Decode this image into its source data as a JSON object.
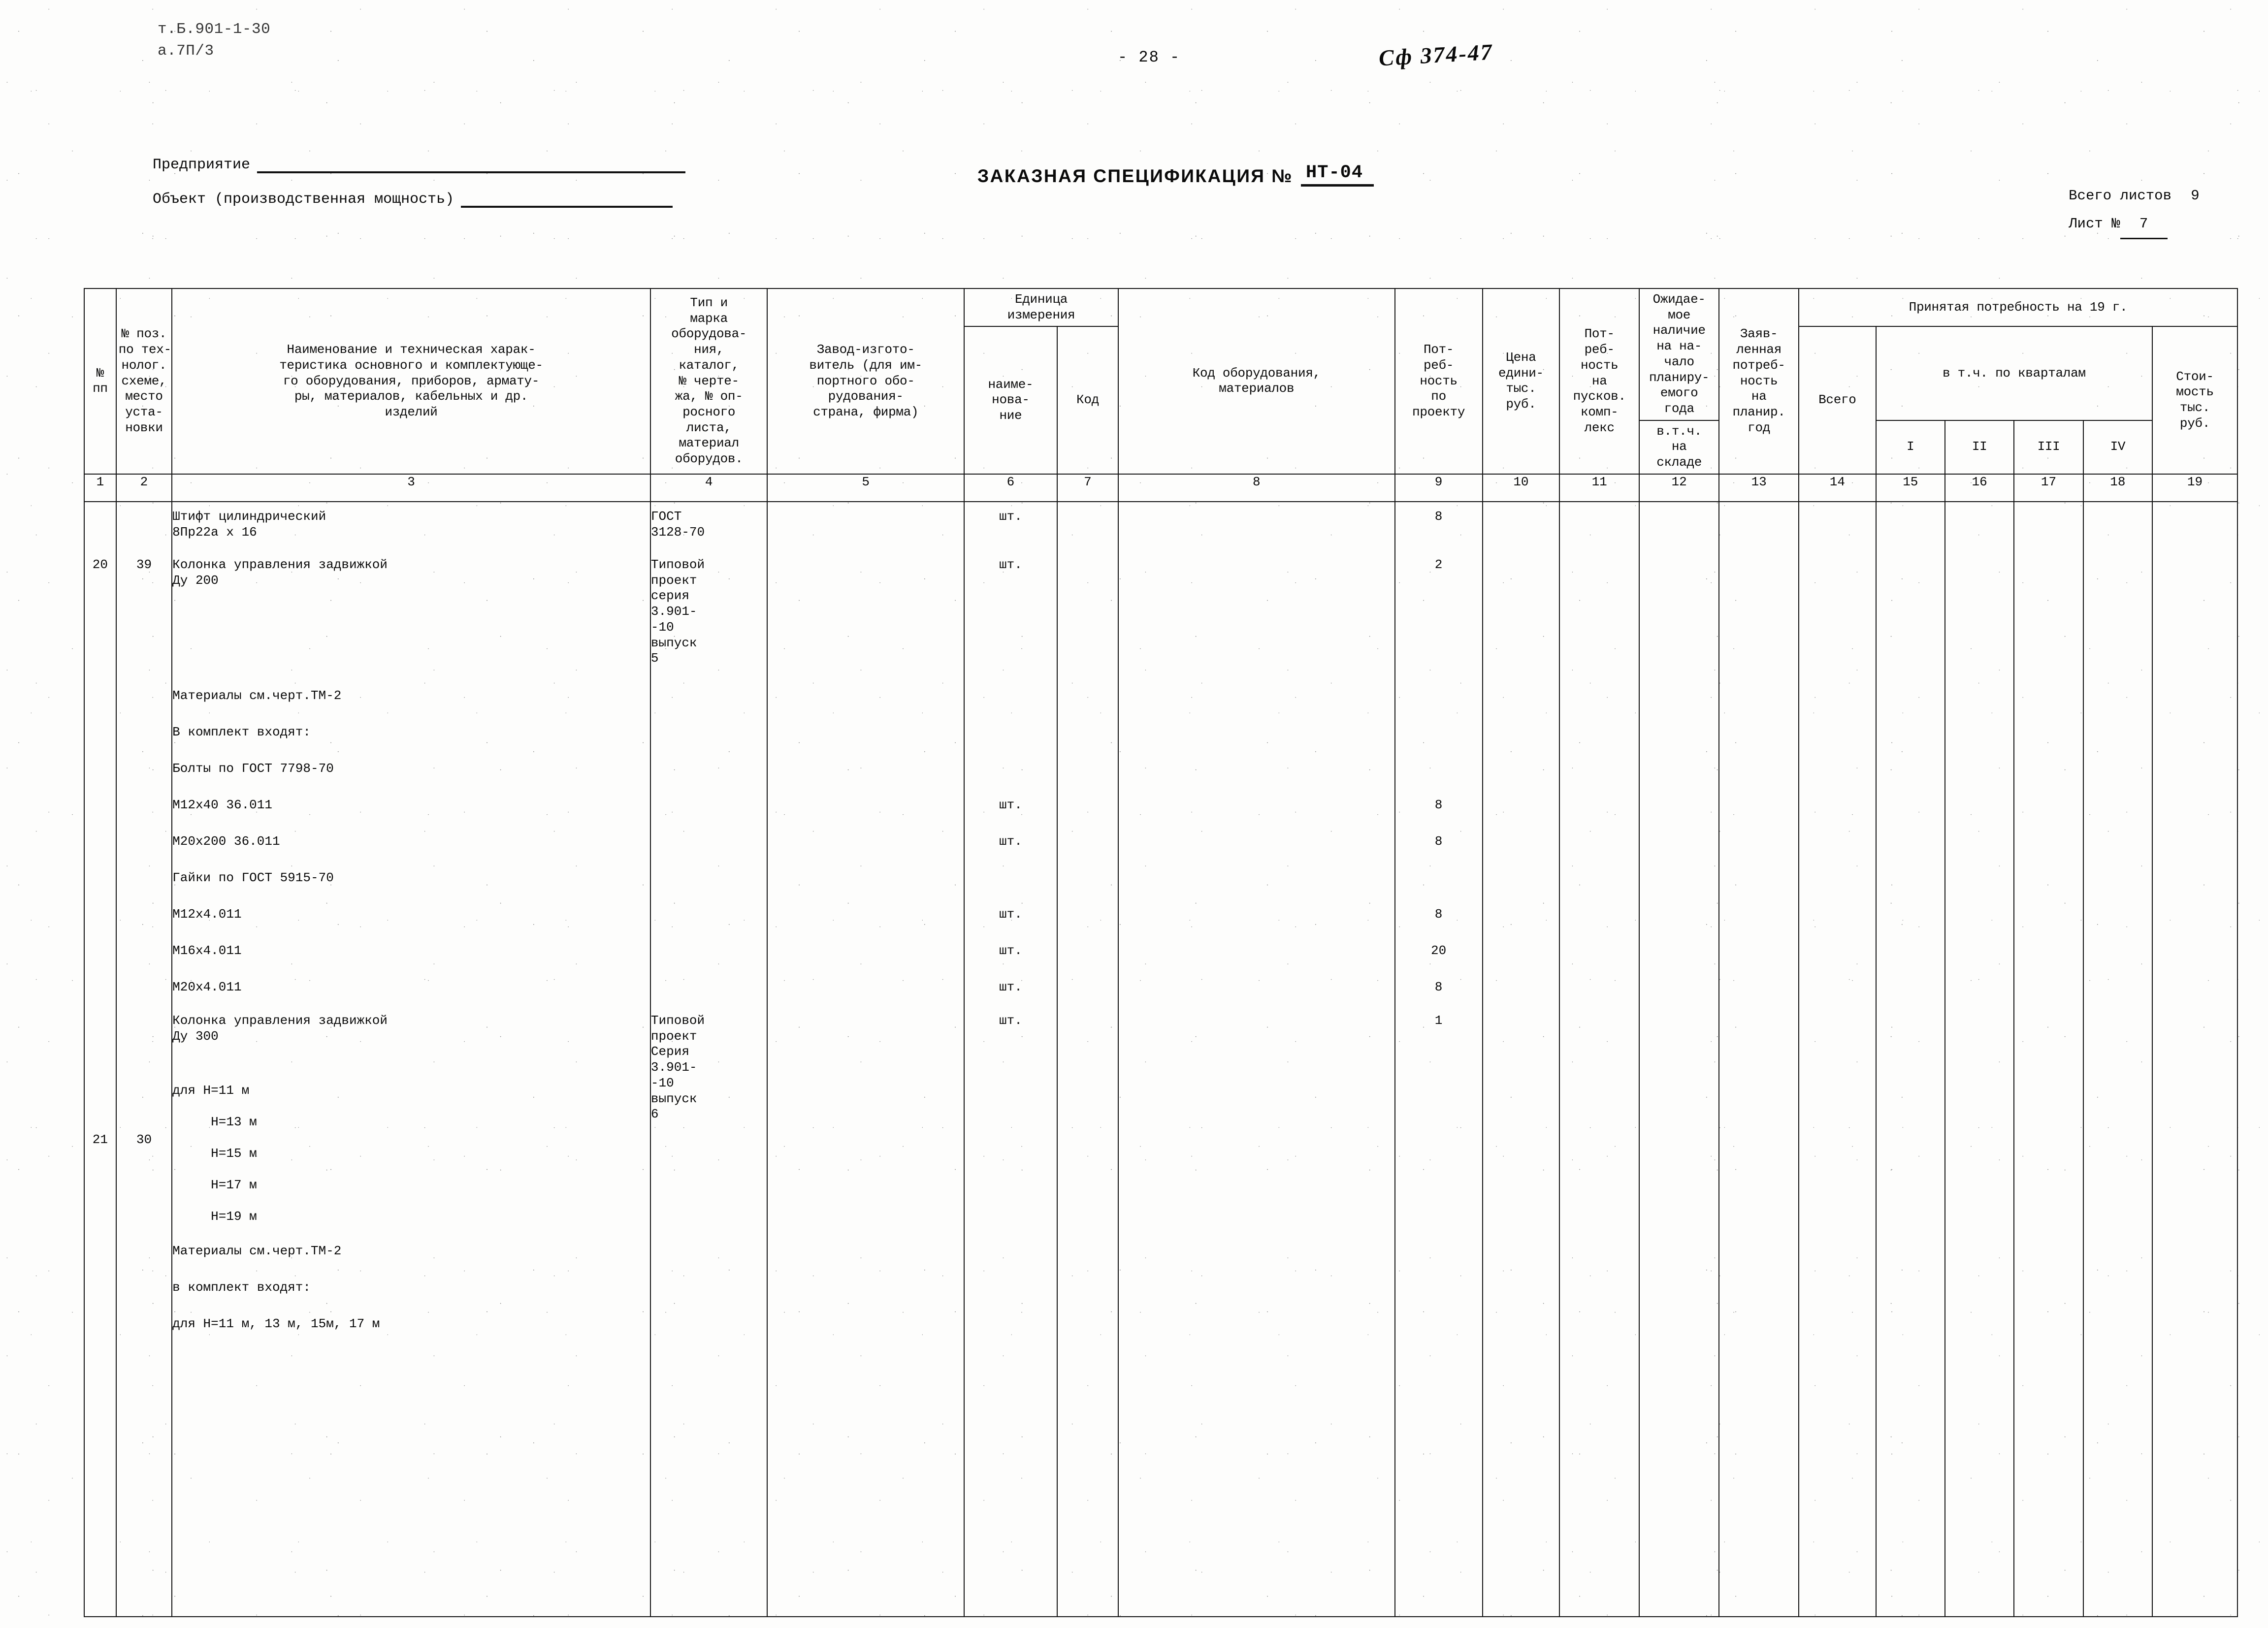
{
  "header": {
    "doc_code_line1": "т.Б.901-1-30",
    "doc_code_line2": "а.7П/3",
    "page_number": "- 28 -",
    "handwritten_ref": "Сф 374-47",
    "enterprise_label": "Предприятие",
    "object_label": "Объект (производственная мощность)",
    "spec_title": "ЗАКАЗНАЯ СПЕЦИФИКАЦИЯ №",
    "spec_number": "НТ-04",
    "total_sheets_label": "Всего листов",
    "total_sheets_value": "9",
    "sheet_label": "Лист №",
    "sheet_value": "7"
  },
  "table": {
    "headers": {
      "c1": "№\nпп",
      "c2": "№ поз.\nпо тех-\nнолог.\nсхеме,\nместо\nуста-\nновки",
      "c3": "Наименование и техническая харак-\nтеристика основного и комплектующе-\nго оборудования, приборов, армату-\nры, материалов, кабельных и др.\nизделий",
      "c4": "Тип и\nмарка\nоборудова-\nния,\nкаталог,\n№ черте-\nжа, № оп-\nросного\nлиста,\nматериал\nоборудов.",
      "c5": "Завод-изгото-\nвитель (для им-\nпортного обо-\nрудования-\nстрана, фирма)",
      "c6_group": "Единица\nизмерения",
      "c6": "наиме-\nнова-\nние",
      "c7": "Код",
      "c8": "Код оборудования,\nматериалов",
      "c9": "Пот-\nреб-\nность\nпо\nпроекту",
      "c10": "Цена\nедини-\nтыс.\nруб.",
      "c11": "Пот-\nреб-\nность\nна\nпусков.\nкомп-\nлекс",
      "c12_group": "Ожидае-\nмое\nналичие\nна на-\nчало\nпланиру-\nемого\nгода",
      "c12b": "в.т.ч.\nна\nскладе",
      "c13": "Заяв-\nленная\nпотреб-\nность\nна\nпланир.\nгод",
      "c14_group": "Принятая потребность на 19        г.",
      "c14": "Всего",
      "c15_group": "в т.ч. по кварталам",
      "c15": "I",
      "c16": "II",
      "c17": "III",
      "c18": "IV",
      "c19": "Стои-\nмость\nтыс.\nруб."
    },
    "column_numbers": [
      "1",
      "2",
      "3",
      "4",
      "5",
      "6",
      "7",
      "8",
      "9",
      "10",
      "11",
      "12",
      "13",
      "14",
      "15",
      "16",
      "17",
      "18",
      "19"
    ],
    "rows": [
      {
        "pos": "",
        "npp": "",
        "name": "Штифт цилиндрический\n8Пр22а х 16",
        "type": "ГОСТ\n3128-70",
        "unit": "шт.",
        "qty": "8"
      },
      {
        "pos": "20",
        "npp": "39",
        "name": "Колонка управления задвижкой\nДу 200",
        "type": "Типовой\nпроект\nсерия\n3.901-\n-10\nвыпуск\n5",
        "unit": "шт.",
        "qty": "2"
      },
      {
        "pos": "",
        "npp": "",
        "name": "Материалы см.черт.ТМ-2",
        "type": "",
        "unit": "",
        "qty": ""
      },
      {
        "pos": "",
        "npp": "",
        "name": "В комплект входят:",
        "type": "",
        "unit": "",
        "qty": ""
      },
      {
        "pos": "",
        "npp": "",
        "name": "Болты по ГОСТ 7798-70",
        "type": "",
        "unit": "",
        "qty": ""
      },
      {
        "pos": "",
        "npp": "",
        "name": "М12х40 36.011",
        "type": "",
        "unit": "шт.",
        "qty": "8"
      },
      {
        "pos": "",
        "npp": "",
        "name": "М20х200 36.011",
        "type": "",
        "unit": "шт.",
        "qty": "8"
      },
      {
        "pos": "",
        "npp": "",
        "name": "Гайки по ГОСТ 5915-70",
        "type": "",
        "unit": "",
        "qty": ""
      },
      {
        "pos": "",
        "npp": "",
        "name": "М12х4.011",
        "type": "",
        "unit": "шт.",
        "qty": "8"
      },
      {
        "pos": "",
        "npp": "",
        "name": "М16х4.011",
        "type": "",
        "unit": "шт.",
        "qty": "20"
      },
      {
        "pos": "",
        "npp": "",
        "name": "М20х4.011",
        "type": "",
        "unit": "шт.",
        "qty": "8"
      },
      {
        "pos": "21",
        "npp": "30",
        "name": "Колонка управления задвижкой\nДу 300",
        "type": "Типовой\nпроект\nСерия\n3.901-\n-10\nвыпуск\n6",
        "unit": "шт.",
        "qty": "1"
      },
      {
        "pos": "",
        "npp": "",
        "name": "для H=11 м",
        "type": "",
        "unit": "",
        "qty": ""
      },
      {
        "pos": "",
        "npp": "",
        "name": "     H=13 м",
        "type": "",
        "unit": "",
        "qty": ""
      },
      {
        "pos": "",
        "npp": "",
        "name": "     H=15 м",
        "type": "",
        "unit": "",
        "qty": ""
      },
      {
        "pos": "",
        "npp": "",
        "name": "     H=17 м",
        "type": "",
        "unit": "",
        "qty": ""
      },
      {
        "pos": "",
        "npp": "",
        "name": "     H=19 м",
        "type": "",
        "unit": "",
        "qty": ""
      },
      {
        "pos": "",
        "npp": "",
        "name": "Материалы см.черт.ТМ-2",
        "type": "",
        "unit": "",
        "qty": ""
      },
      {
        "pos": "",
        "npp": "",
        "name": "в комплект входят:",
        "type": "",
        "unit": "",
        "qty": ""
      },
      {
        "pos": "",
        "npp": "",
        "name": "для H=11 м, 13 м, 15м, 17 м",
        "type": "",
        "unit": "",
        "qty": ""
      }
    ]
  }
}
